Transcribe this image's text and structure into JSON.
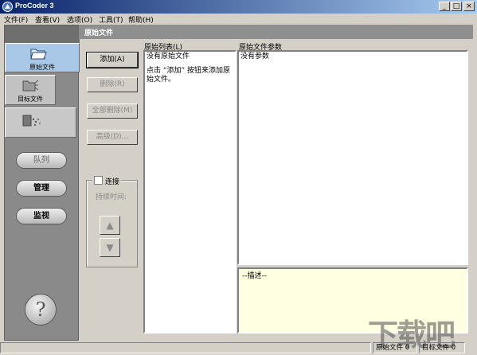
{
  "window": {
    "title": "ProCoder 3",
    "minimize": "_",
    "maximize": "□",
    "close": "×"
  },
  "menu": [
    "文件(F)",
    "查看(V)",
    "选项(O)",
    "工具(T)",
    "帮助(H)"
  ],
  "sidebar": {
    "tabs": [
      {
        "label": "原始文件"
      },
      {
        "label": "目标文件"
      },
      {
        "label": ""
      }
    ],
    "buttons": [
      {
        "label": "队列"
      },
      {
        "label": "管理"
      },
      {
        "label": "监视"
      }
    ],
    "help": "?"
  },
  "header": {
    "title": "原始文件"
  },
  "actions": {
    "add": "添加(A)",
    "delete": "删除(R)",
    "delete_all": "全部删除(M)",
    "advanced": "高级(D)..."
  },
  "connect": {
    "label": "连接",
    "duration_label": "持续时间:",
    "up": "▲",
    "down": "▼"
  },
  "source_list": {
    "label": "原始列表(L)",
    "empty": "没有原始文件",
    "hint_line1": "点击 “添加” 按钮来添加原",
    "hint_line2": "始文件。"
  },
  "params": {
    "label": "原始文件参数",
    "empty": "没有参数"
  },
  "description": {
    "text": "--描述--"
  },
  "status": {
    "source_count": "原始文件 0",
    "target_count": "目标文件 0"
  },
  "colors": {
    "title_start": "#0a246a",
    "title_end": "#a6caf0",
    "sidebar": "#8a8a8a",
    "desc_bg": "#ffffe1"
  },
  "watermark": "下载吧"
}
